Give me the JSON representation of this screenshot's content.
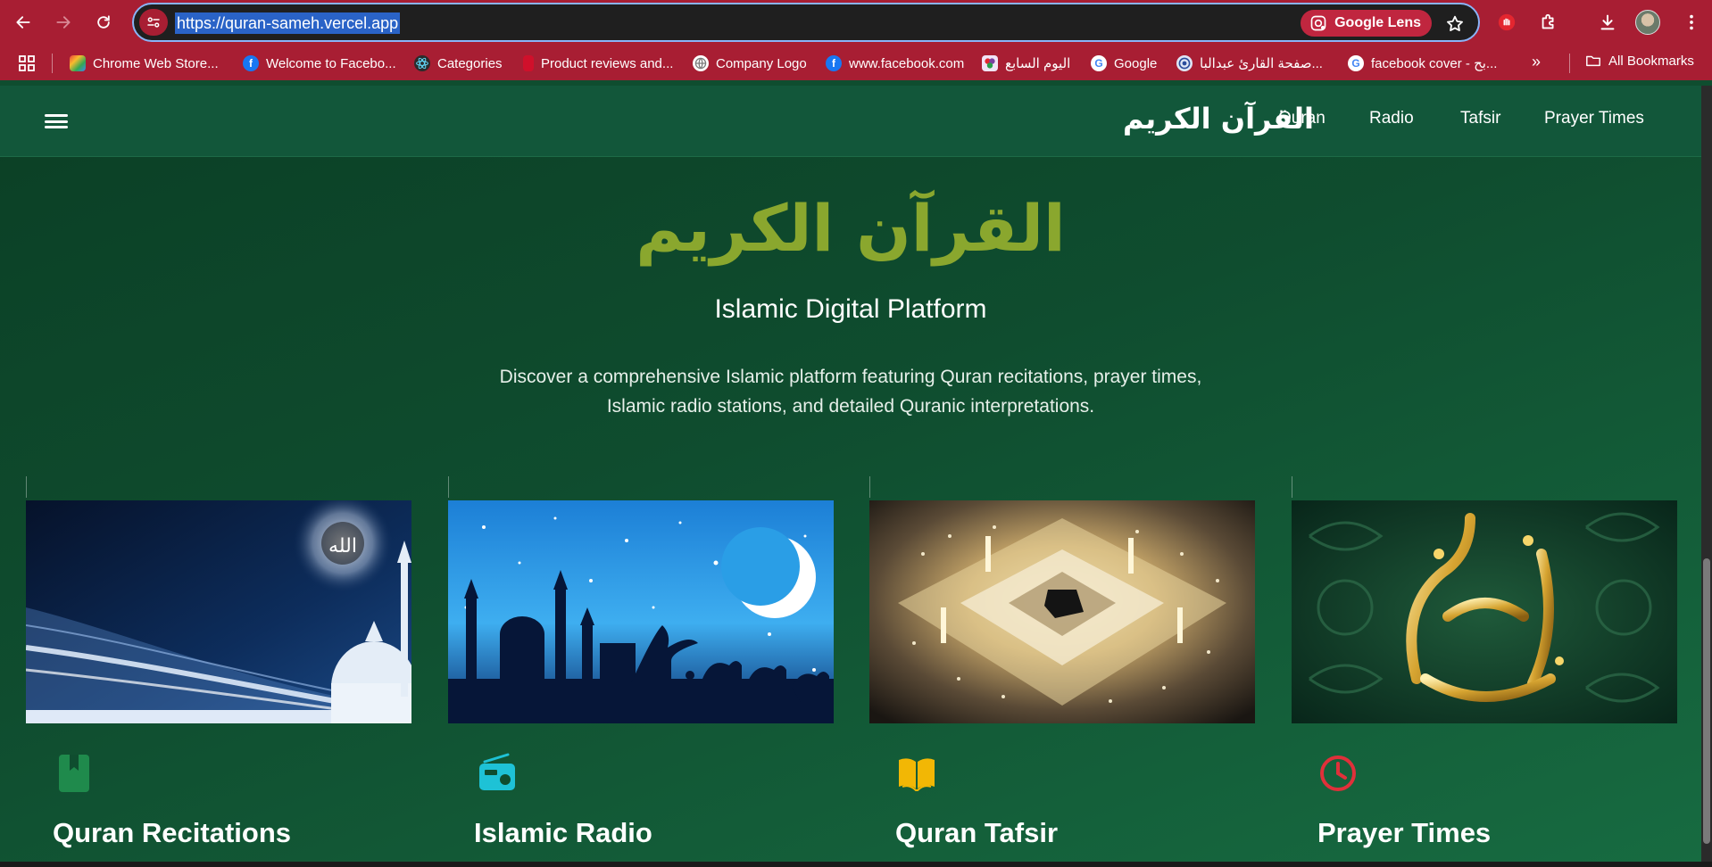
{
  "browser": {
    "url": "https://quran-sameh.vercel.app",
    "lens_label": "Google Lens",
    "bookmarks": [
      {
        "label": "Chrome Web Store...",
        "icon": "chrome-web-store-icon",
        "color": "#e8453c"
      },
      {
        "label": "Welcome to Facebo...",
        "icon": "facebook-icon",
        "color": "#1877f2"
      },
      {
        "label": "Categories",
        "icon": "react-icon",
        "color": "#2b2b2b"
      },
      {
        "label": "Product reviews and...",
        "icon": "product-reviews-icon",
        "color": "#d0102b"
      },
      {
        "label": "Company Logo",
        "icon": "globe-icon",
        "color": "#7a7a7a"
      },
      {
        "label": "www.facebook.com",
        "icon": "facebook-icon",
        "color": "#1877f2"
      },
      {
        "label": "اليوم السابع",
        "icon": "youm7-icon",
        "color": "#7b3fa0"
      },
      {
        "label": "Google",
        "icon": "google-icon",
        "color": "#ffffff"
      },
      {
        "label": "صفحة القارئ عبدالبا...",
        "icon": "quran-site-icon",
        "color": "#2a4c9c"
      },
      {
        "label": "facebook cover - بح...",
        "icon": "google-icon",
        "color": "#ffffff"
      }
    ],
    "all_bookmarks_label": "All Bookmarks"
  },
  "header": {
    "brand": "القرآن الكريم",
    "nav": [
      "Quran",
      "Radio",
      "Tafsir",
      "Prayer Times"
    ]
  },
  "hero": {
    "title": "القرآن الكريم",
    "subtitle": "Islamic Digital Platform",
    "description": "Discover a comprehensive Islamic platform featuring Quran recitations, prayer times, Islamic radio stations, and detailed Quranic interpretations."
  },
  "cards": [
    {
      "title": "Quran Recitations",
      "icon": "book-icon",
      "icon_color": "#1f8a4c",
      "image": "mosque-light-rays-image"
    },
    {
      "title": "Islamic Radio",
      "icon": "radio-icon",
      "icon_color": "#1ec2d6",
      "image": "crescent-desert-night-image"
    },
    {
      "title": "Quran Tafsir",
      "icon": "open-book-icon",
      "icon_color": "#f2b705",
      "image": "kaaba-aerial-image"
    },
    {
      "title": "Prayer Times",
      "icon": "clock-icon",
      "icon_color": "#e0303a",
      "image": "golden-calligraphy-image"
    }
  ],
  "colors": {
    "chrome": "#a81e33",
    "page_bg": "#0f4d2f",
    "header_bg": "#12573a",
    "accent_title": "#8aa72e"
  }
}
